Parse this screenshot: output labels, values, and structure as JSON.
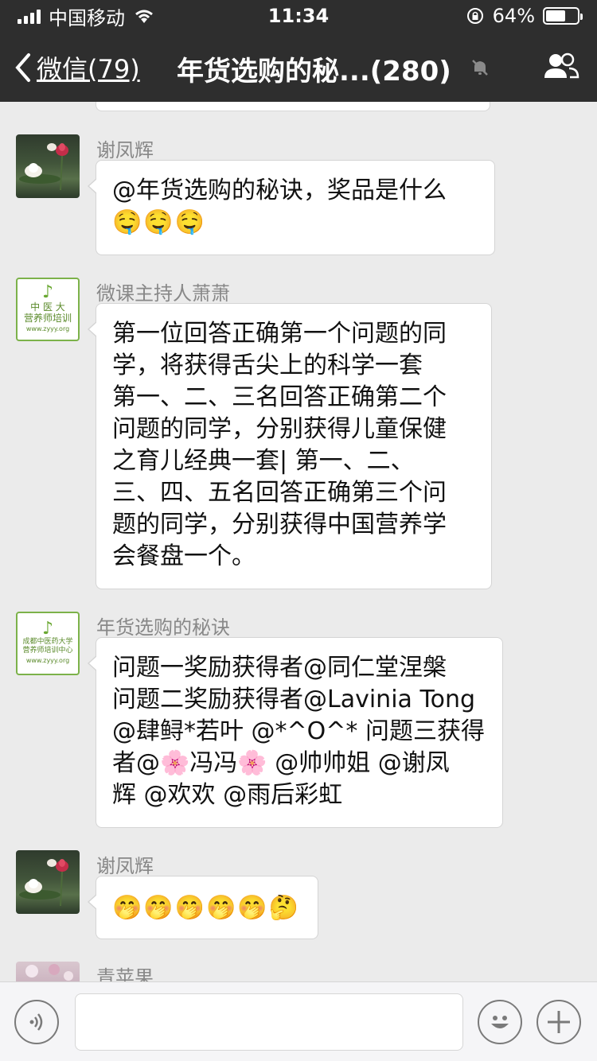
{
  "status_bar": {
    "carrier": "中国移动",
    "time": "11:34",
    "battery": "64%",
    "battery_level": 0.64
  },
  "nav": {
    "back_label": "微信(79)",
    "title": "年货选购的秘...(280)"
  },
  "messages": [
    {
      "sender": "谢凤辉",
      "lines": [
        "@年货选购的秘诀，奖品是什么"
      ],
      "emoji": "🤤🤤🤤"
    },
    {
      "sender": "微课主持人萧萧",
      "avatar_text": {
        "line1": "中 医 大",
        "line2": "营养师培训",
        "url": "www.zyyy.org"
      },
      "lines": [
        "第一位回答正确第一个问题的同",
        "学，将获得舌尖上的科学一套",
        "第一、二、三名回答正确第二个",
        "问题的同学，分别获得儿童保健",
        "之育儿经典一套| 第一、二、",
        "三、四、五名回答正确第三个问",
        "题的同学，分别获得中国营养学",
        "会餐盘一个。"
      ]
    },
    {
      "sender": "年货选购的秘诀",
      "avatar_text": {
        "line1": "成都中医药大学",
        "line2": "营养师培训中心",
        "url": "www.zyyy.org"
      },
      "lines": [
        "问题一奖励获得者@同仁堂涅槃",
        "问题二奖励获得者@Lavinia Tong",
        " @肆鲟*若叶 @*^O^* 问题三获得",
        "者@🌸冯冯🌸 @帅帅姐 @谢凤",
        "辉 @欢欢 @雨后彩虹"
      ]
    },
    {
      "sender": "谢凤辉",
      "emoji": "🤭🤭🤭🤭🤭🤔"
    },
    {
      "sender": "青苹果"
    }
  ],
  "icons": {
    "back": "chevron-left-icon",
    "mute": "bell-mute-icon",
    "members": "people-icon",
    "voice": "voice-icon",
    "emoji": "smile-icon",
    "plus": "plus-icon"
  },
  "colors": {
    "bar": "#2e2e2e",
    "chat_bg": "#ebebeb",
    "bubble": "#ffffff",
    "sender": "#888888"
  }
}
